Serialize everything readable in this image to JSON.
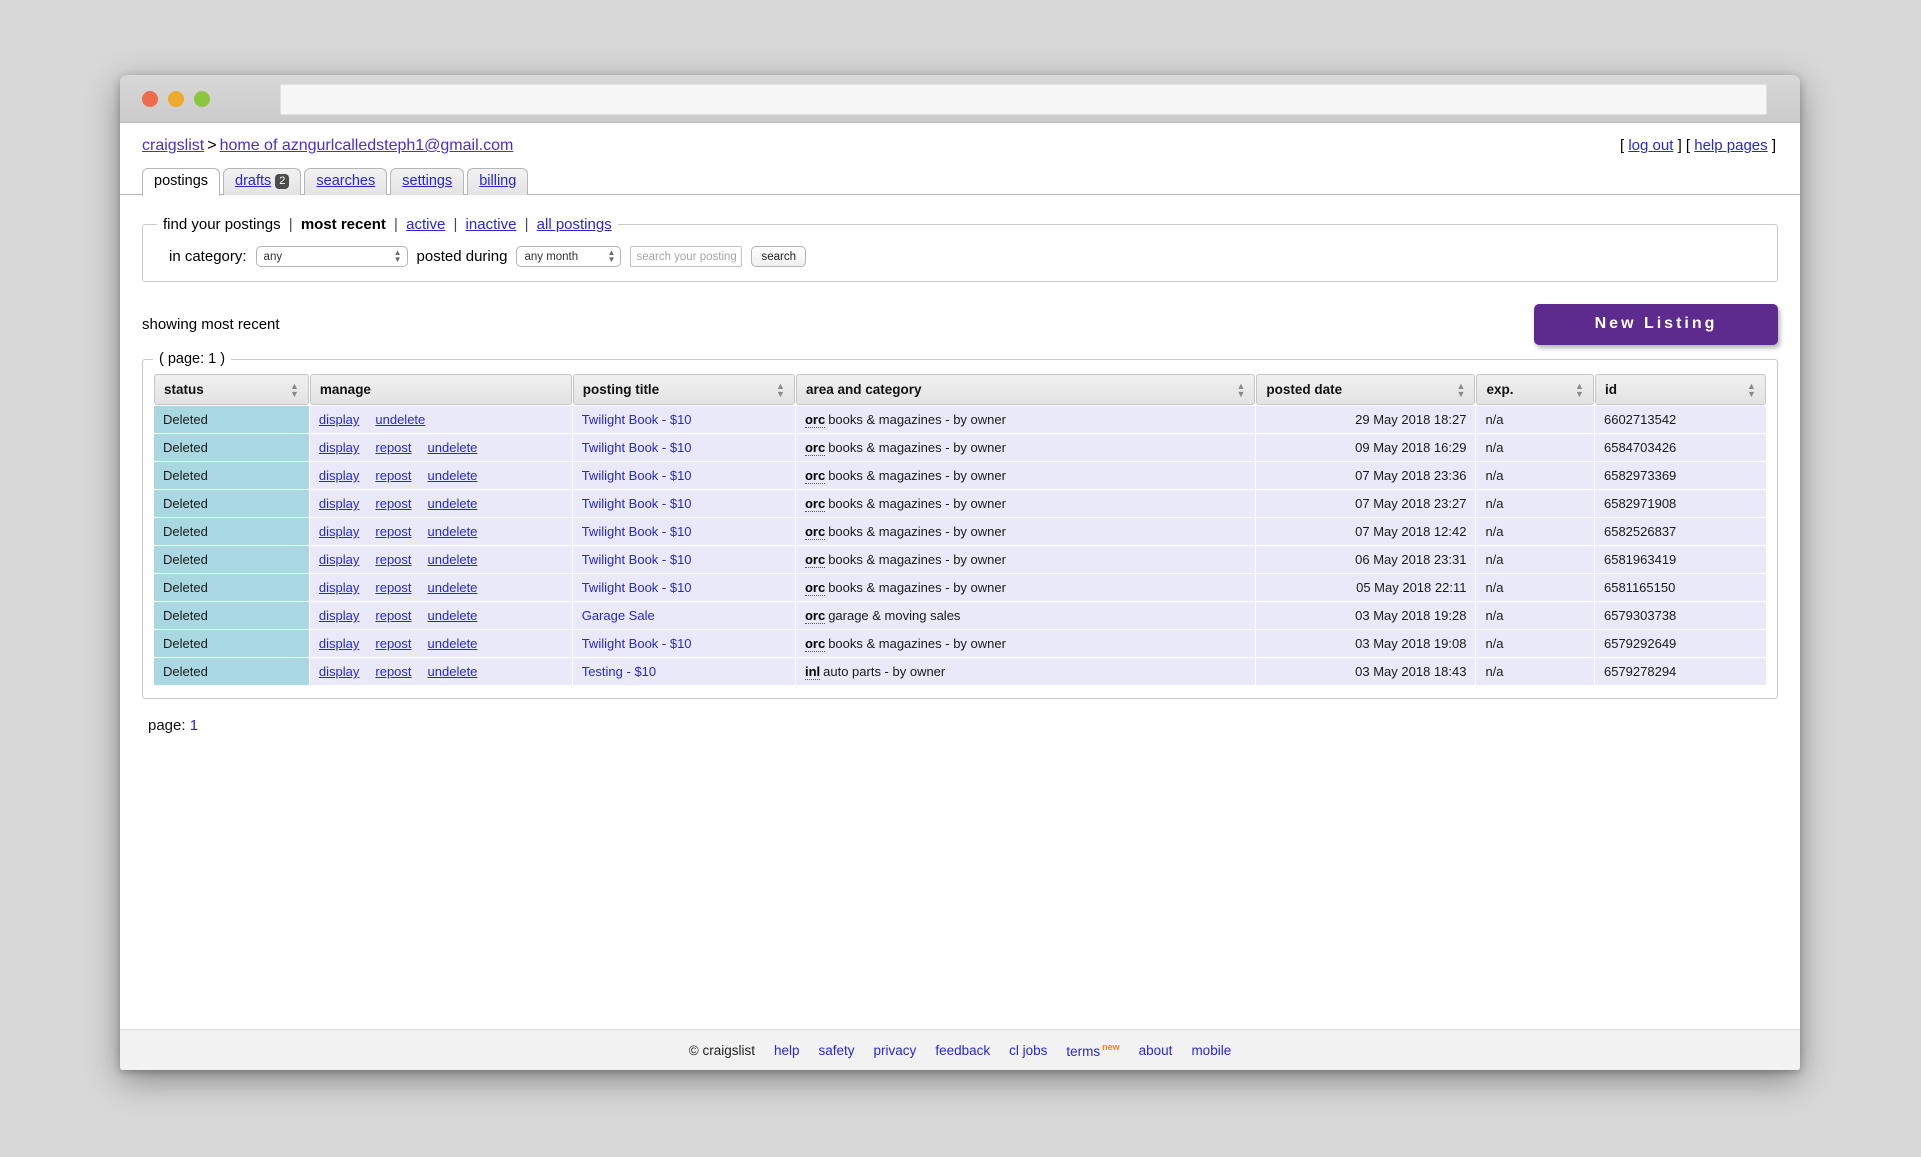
{
  "browser": {
    "traffic_lights": [
      "close",
      "minimize",
      "zoom"
    ],
    "address_value": ""
  },
  "header": {
    "breadcrumb_root": "craigslist",
    "breadcrumb_separator": ">",
    "breadcrumb_account": "home of azngurlcalledsteph1@gmail.com",
    "log_out": "log out",
    "help_pages": "help pages",
    "bracket_open": "[",
    "bracket_close": "]"
  },
  "tabs": [
    {
      "label": "postings",
      "badge": null,
      "active": true
    },
    {
      "label": "drafts",
      "badge": "2",
      "active": false
    },
    {
      "label": "searches",
      "badge": null,
      "active": false
    },
    {
      "label": "settings",
      "badge": null,
      "active": false
    },
    {
      "label": "billing",
      "badge": null,
      "active": false
    }
  ],
  "search_panel": {
    "legend_title": "find your postings",
    "filters": [
      {
        "label": "most recent",
        "active": true
      },
      {
        "label": "active",
        "active": false
      },
      {
        "label": "inactive",
        "active": false
      },
      {
        "label": "all postings",
        "active": false
      }
    ],
    "separator": "|",
    "category_label": "in category:",
    "category_value": "any",
    "posted_during_label": "posted during",
    "posted_during_value": "any month",
    "search_placeholder": "search your postings",
    "search_value": "",
    "search_button": "search"
  },
  "results": {
    "showing_text": "showing most recent",
    "new_listing_button": "New Listing",
    "page_legend": "( page: 1 )",
    "page_foot_label": "page:",
    "page_foot_value": "1",
    "columns": [
      {
        "key": "status",
        "label": "status",
        "sortable": true
      },
      {
        "key": "manage",
        "label": "manage",
        "sortable": false
      },
      {
        "key": "title",
        "label": "posting title",
        "sortable": true
      },
      {
        "key": "area",
        "label": "area and category",
        "sortable": true
      },
      {
        "key": "date",
        "label": "posted date",
        "sortable": true
      },
      {
        "key": "exp",
        "label": "exp.",
        "sortable": true
      },
      {
        "key": "id",
        "label": "id",
        "sortable": true
      }
    ],
    "rows": [
      {
        "status": "Deleted",
        "actions": [
          "display",
          "undelete"
        ],
        "title": "Twilight Book - $10",
        "area_abbr": "orc",
        "area_text": "books & magazines - by owner",
        "date": "29 May 2018 18:27",
        "exp": "n/a",
        "id": "6602713542"
      },
      {
        "status": "Deleted",
        "actions": [
          "display",
          "repost",
          "undelete"
        ],
        "title": "Twilight Book - $10",
        "area_abbr": "orc",
        "area_text": "books & magazines - by owner",
        "date": "09 May 2018 16:29",
        "exp": "n/a",
        "id": "6584703426"
      },
      {
        "status": "Deleted",
        "actions": [
          "display",
          "repost",
          "undelete"
        ],
        "title": "Twilight Book - $10",
        "area_abbr": "orc",
        "area_text": "books & magazines - by owner",
        "date": "07 May 2018 23:36",
        "exp": "n/a",
        "id": "6582973369"
      },
      {
        "status": "Deleted",
        "actions": [
          "display",
          "repost",
          "undelete"
        ],
        "title": "Twilight Book - $10",
        "area_abbr": "orc",
        "area_text": "books & magazines - by owner",
        "date": "07 May 2018 23:27",
        "exp": "n/a",
        "id": "6582971908"
      },
      {
        "status": "Deleted",
        "actions": [
          "display",
          "repost",
          "undelete"
        ],
        "title": "Twilight Book - $10",
        "area_abbr": "orc",
        "area_text": "books & magazines - by owner",
        "date": "07 May 2018 12:42",
        "exp": "n/a",
        "id": "6582526837"
      },
      {
        "status": "Deleted",
        "actions": [
          "display",
          "repost",
          "undelete"
        ],
        "title": "Twilight Book - $10",
        "area_abbr": "orc",
        "area_text": "books & magazines - by owner",
        "date": "06 May 2018 23:31",
        "exp": "n/a",
        "id": "6581963419"
      },
      {
        "status": "Deleted",
        "actions": [
          "display",
          "repost",
          "undelete"
        ],
        "title": "Twilight Book - $10",
        "area_abbr": "orc",
        "area_text": "books & magazines - by owner",
        "date": "05 May 2018 22:11",
        "exp": "n/a",
        "id": "6581165150"
      },
      {
        "status": "Deleted",
        "actions": [
          "display",
          "repost",
          "undelete"
        ],
        "title": "Garage Sale",
        "area_abbr": "orc",
        "area_text": "garage & moving sales",
        "date": "03 May 2018 19:28",
        "exp": "n/a",
        "id": "6579303738"
      },
      {
        "status": "Deleted",
        "actions": [
          "display",
          "repost",
          "undelete"
        ],
        "title": "Twilight Book - $10",
        "area_abbr": "orc",
        "area_text": "books & magazines - by owner",
        "date": "03 May 2018 19:08",
        "exp": "n/a",
        "id": "6579292649"
      },
      {
        "status": "Deleted",
        "actions": [
          "display",
          "repost",
          "undelete"
        ],
        "title": "Testing - $10",
        "area_abbr": "inl",
        "area_text": "auto parts - by owner",
        "date": "03 May 2018 18:43",
        "exp": "n/a",
        "id": "6579278294"
      }
    ]
  },
  "footer": {
    "copyright": "© craigslist",
    "links": [
      {
        "label": "help",
        "flag": null
      },
      {
        "label": "safety",
        "flag": null
      },
      {
        "label": "privacy",
        "flag": null
      },
      {
        "label": "feedback",
        "flag": null
      },
      {
        "label": "cl jobs",
        "flag": null
      },
      {
        "label": "terms",
        "flag": "new"
      },
      {
        "label": "about",
        "flag": null
      },
      {
        "label": "mobile",
        "flag": null
      }
    ]
  },
  "colors": {
    "accent_purple": "#5d2a8e",
    "link_blue": "#2727d6",
    "status_cell": "#a9d8e2",
    "row_bg": "#e9e9f9",
    "new_flag_orange": "#f08a1e"
  }
}
